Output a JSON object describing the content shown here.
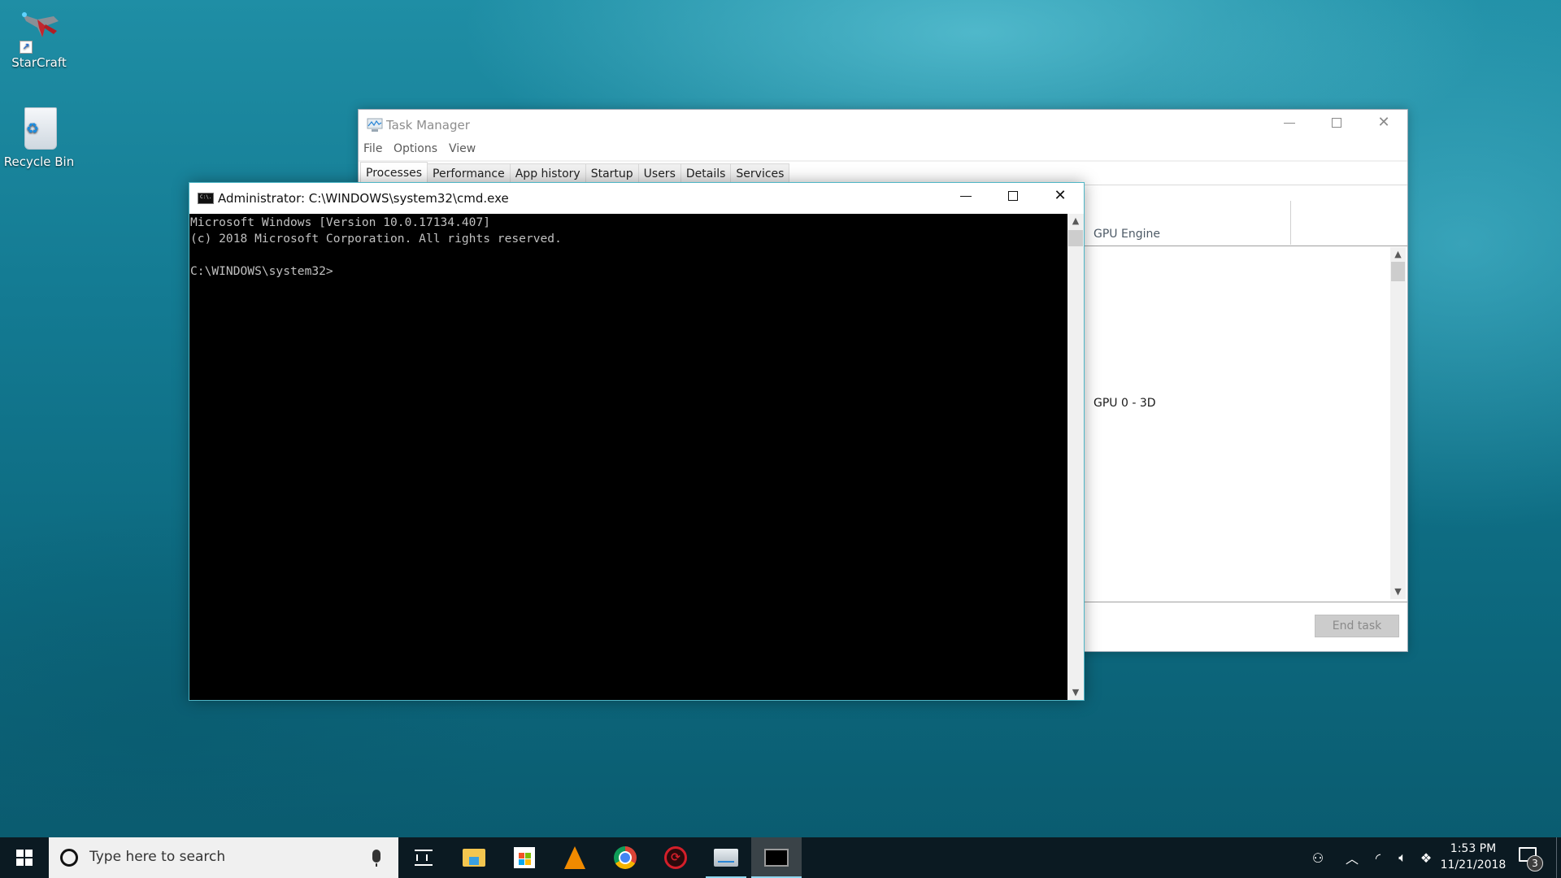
{
  "desktop": {
    "icons": [
      {
        "label": "StarCraft",
        "icon": "starcraft-shortcut-icon"
      },
      {
        "label": "Recycle Bin",
        "icon": "recycle-bin-icon"
      }
    ]
  },
  "task_manager": {
    "title": "Task Manager",
    "menu": [
      "File",
      "Options",
      "View"
    ],
    "tabs": [
      {
        "label": "Processes",
        "active": true
      },
      {
        "label": "Performance",
        "active": false
      },
      {
        "label": "App history",
        "active": false
      },
      {
        "label": "Startup",
        "active": false
      },
      {
        "label": "Users",
        "active": false
      },
      {
        "label": "Details",
        "active": false
      },
      {
        "label": "Services",
        "active": false
      }
    ],
    "columns": {
      "gpu_engine": "GPU Engine"
    },
    "rows": [
      {
        "gpu_engine": "GPU 0 - 3D"
      }
    ],
    "end_task_label": "End task",
    "end_task_enabled": false
  },
  "cmd": {
    "title": "Administrator: C:\\WINDOWS\\system32\\cmd.exe",
    "icon_text": "C:\\.",
    "lines": [
      "Microsoft Windows [Version 10.0.17134.407]",
      "(c) 2018 Microsoft Corporation. All rights reserved.",
      "",
      "C:\\WINDOWS\\system32>"
    ]
  },
  "taskbar": {
    "search_placeholder": "Type here to search",
    "apps": [
      {
        "name": "Task View",
        "icon": "task-view-icon"
      },
      {
        "name": "File Explorer",
        "icon": "file-explorer-icon"
      },
      {
        "name": "Microsoft Store",
        "icon": "store-icon"
      },
      {
        "name": "VLC media player",
        "icon": "vlc-icon"
      },
      {
        "name": "Google Chrome",
        "icon": "chrome-icon"
      },
      {
        "name": "GeForce Experience",
        "icon": "geforce-icon"
      },
      {
        "name": "Task Manager",
        "icon": "task-manager-icon",
        "running": true
      },
      {
        "name": "Command Prompt",
        "icon": "cmd-icon",
        "running": true,
        "active": true
      }
    ],
    "tray": {
      "time": "1:53 PM",
      "date": "11/21/2018",
      "notification_count": "3"
    },
    "colors": {
      "running_indicator": "#8fd6ee",
      "taskbar_bg": "#0b1a22"
    }
  }
}
